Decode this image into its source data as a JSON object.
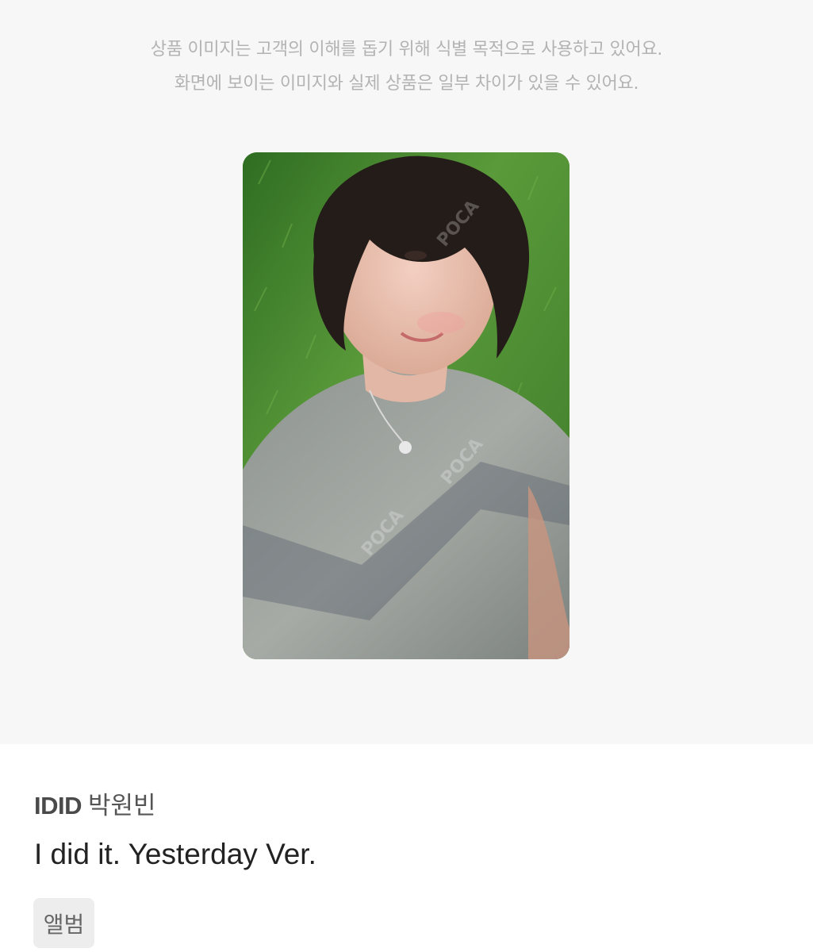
{
  "notice": {
    "line1": "상품 이미지는 고객의 이해를 돕기 위해 식별 목적으로 사용하고 있어요.",
    "line2": "화면에 보이는 이미지와 실제 상품은 일부 차이가 있을 수 있어요."
  },
  "product": {
    "image_icon": "photocard-image",
    "artist_group": "IDID",
    "artist_member": "박원빈",
    "album": "I did it. Yesterday Ver.",
    "tag": "앨범"
  },
  "colors": {
    "background_top": "#f7f7f7",
    "notice_text": "#b3b3b3",
    "title_text": "#222222",
    "tag_bg": "#ededed"
  }
}
